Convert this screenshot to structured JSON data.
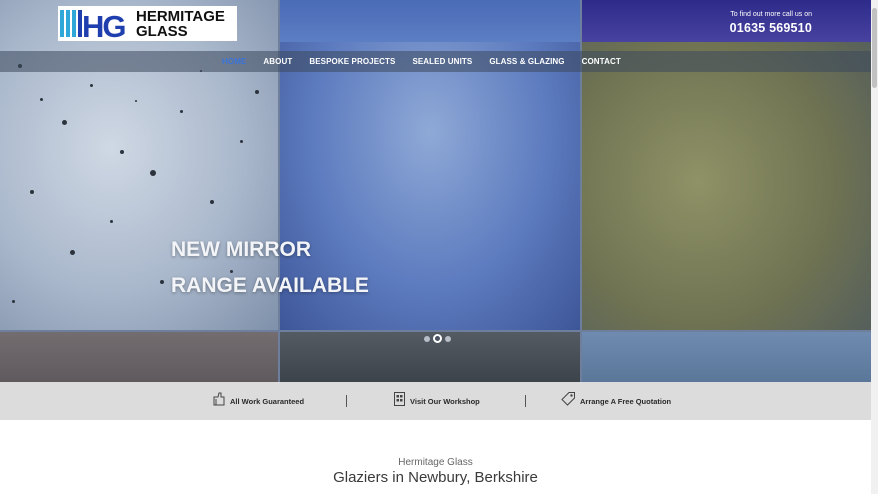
{
  "brand": {
    "name_line1": "HERMITAGE",
    "name_line2": "GLASS",
    "mark": "HG",
    "colors": {
      "primary": "#1f3fae",
      "accent": "#2fa7d8"
    }
  },
  "header": {
    "contact_label": "To find out more call us on",
    "phone": "01635 569510"
  },
  "nav": {
    "items": [
      {
        "label": "HOME",
        "active": true
      },
      {
        "label": "ABOUT",
        "active": false
      },
      {
        "label": "BESPOKE PROJECTS",
        "active": false
      },
      {
        "label": "SEALED UNITS",
        "active": false
      },
      {
        "label": "GLASS & GLAZING",
        "active": false
      },
      {
        "label": "CONTACT",
        "active": false
      }
    ]
  },
  "hero": {
    "line1": "NEW MIRROR",
    "line2": "RANGE AVAILABLE",
    "slides": {
      "count": 3,
      "active_index": 1
    }
  },
  "features": [
    {
      "label": "All Work Guaranteed",
      "icon": "guarantee-icon"
    },
    {
      "label": "Visit Our Workshop",
      "icon": "workshop-icon"
    },
    {
      "label": "Arrange A Free Quotation",
      "icon": "tag-icon"
    }
  ],
  "intro": {
    "subtitle": "Hermitage Glass",
    "title": "Glaziers in Newbury, Berkshire"
  }
}
